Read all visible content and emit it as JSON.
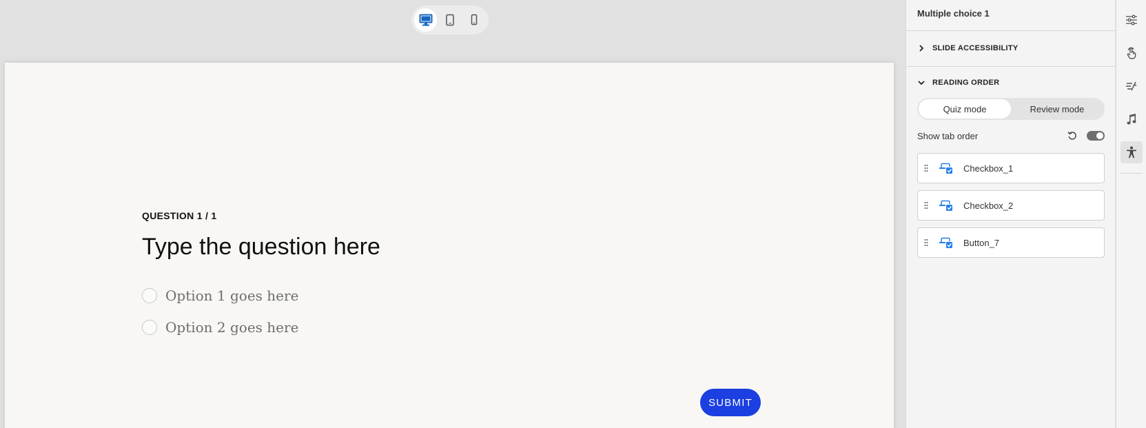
{
  "device_switcher": {
    "options": [
      {
        "icon": "desktop-icon",
        "active": true
      },
      {
        "icon": "tablet-icon",
        "active": false
      },
      {
        "icon": "mobile-icon",
        "active": false
      }
    ]
  },
  "slide": {
    "question_counter": "QUESTION 1 / 1",
    "question_title": "Type the question here",
    "options": [
      {
        "label": "Option  1 goes here"
      },
      {
        "label": "Option  2 goes here"
      }
    ],
    "submit_label": "SUBMIT",
    "submit_color": "#1b3fe0"
  },
  "panel": {
    "title": "Multiple choice 1",
    "slide_accessibility": "SLIDE ACCESSIBILITY",
    "reading_order": "READING ORDER",
    "modes": {
      "quiz": "Quiz mode",
      "review": "Review mode",
      "active": "quiz"
    },
    "show_tab_order_label": "Show tab order",
    "show_tab_order_on": true,
    "order_items": [
      {
        "label": "Checkbox_1",
        "icon": "interactive-element-icon"
      },
      {
        "label": "Checkbox_2",
        "icon": "interactive-element-icon"
      },
      {
        "label": "Button_7",
        "icon": "interactive-element-icon"
      }
    ]
  },
  "rail": {
    "icons": [
      "sliders-icon",
      "touch-icon",
      "animation-icon",
      "music-icon",
      "accessibility-icon"
    ],
    "active": "accessibility-icon"
  }
}
